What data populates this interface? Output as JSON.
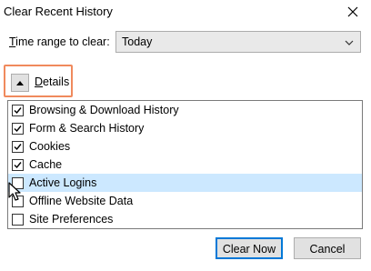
{
  "window": {
    "title": "Clear Recent History"
  },
  "time_range": {
    "label_prefix": "",
    "label_accel": "T",
    "label_rest": "ime range to clear:",
    "selected": "Today"
  },
  "details": {
    "label_accel": "D",
    "label_rest": "etails"
  },
  "items": [
    {
      "label": "Browsing & Download History",
      "checked": true
    },
    {
      "label": "Form & Search History",
      "checked": true
    },
    {
      "label": "Cookies",
      "checked": true
    },
    {
      "label": "Cache",
      "checked": true
    },
    {
      "label": "Active Logins",
      "checked": false
    },
    {
      "label": "Offline Website Data",
      "checked": false
    },
    {
      "label": "Site Preferences",
      "checked": false
    }
  ],
  "buttons": {
    "clear_now": "Clear Now",
    "cancel": "Cancel"
  },
  "colors": {
    "highlight": "#cce8ff",
    "focus_outline": "#f08a5d",
    "primary_border": "#0078d7"
  },
  "icons": {
    "close": "close-icon",
    "dropdown": "chevron-down-icon",
    "collapse": "chevron-up-icon",
    "check": "checkmark-icon",
    "cursor": "mouse-cursor-icon"
  }
}
